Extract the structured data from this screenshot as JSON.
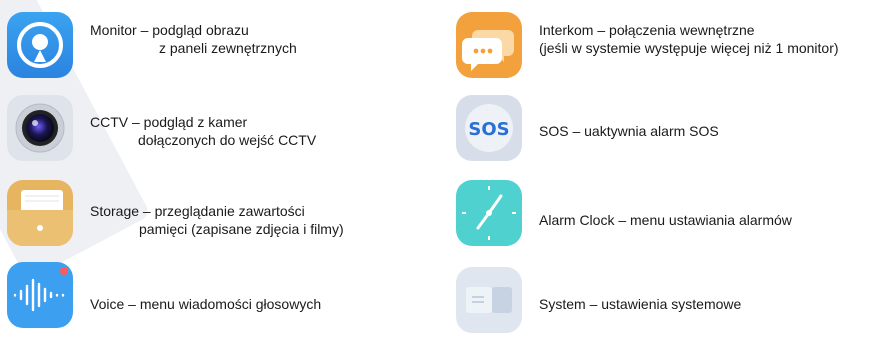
{
  "items": [
    {
      "line1": "Monitor – podgląd obrazu",
      "line2": "z paneli zewnętrznych",
      "icon": "monitor-icon"
    },
    {
      "line1": "Interkom – połączenia wewnętrzne",
      "line2": "(jeśli w systemie występuje więcej niż 1 monitor)",
      "icon": "intercom-chat-icon"
    },
    {
      "line1": "CCTV – podgląd z kamer",
      "line2": "dołączonych do wejść CCTV",
      "icon": "camera-lens-icon"
    },
    {
      "line1": "SOS – uaktywnia alarm SOS",
      "line2": "",
      "icon": "sos-icon",
      "icon_text": "SOS"
    },
    {
      "line1": "Storage – przeglądanie zawartości",
      "line2": "pamięci (zapisane zdjęcia i filmy)",
      "icon": "folder-icon"
    },
    {
      "line1": "Alarm Clock – menu ustawiania alarmów",
      "line2": "",
      "icon": "clock-icon"
    },
    {
      "line1": "Voice – menu wiadomości głosowych",
      "line2": "",
      "icon": "voice-wave-icon"
    },
    {
      "line1": "System – ustawienia systemowe",
      "line2": "",
      "icon": "system-settings-icon"
    }
  ],
  "colors": {
    "monitor_blue": "#2f8fe6",
    "intercom_orange": "#f3a13c",
    "storage_tan": "#e7b45f",
    "clock_teal": "#4fd1cf",
    "voice_blue": "#3d9ff0",
    "sos_blue": "#2a6fd6"
  }
}
